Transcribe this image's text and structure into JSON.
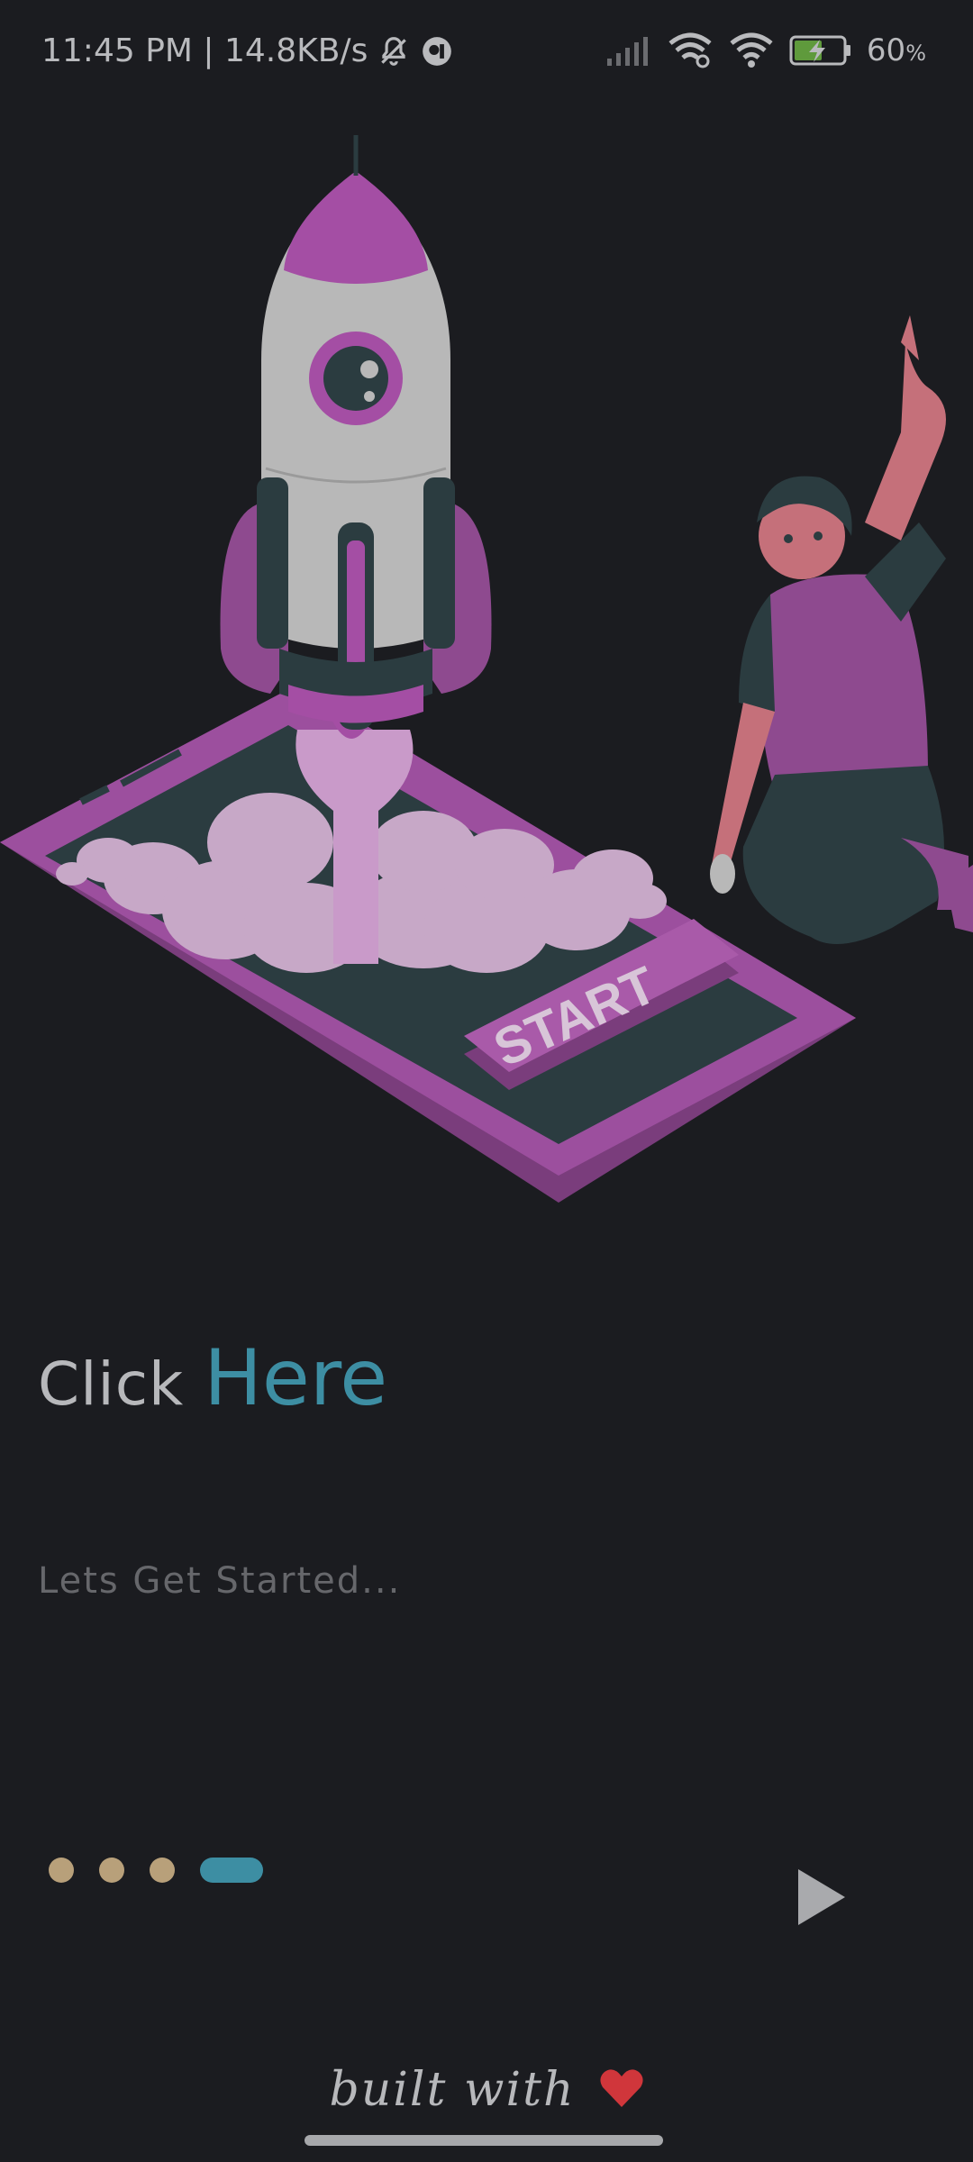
{
  "status_bar": {
    "time_speed": "11:45 PM | 14.8KB/s",
    "battery_percent": "60",
    "battery_unit": "%",
    "icons": [
      "mute-bell-icon",
      "app-notification-icon",
      "signal-icon",
      "wifi-link-icon",
      "wifi-icon",
      "battery-charging-icon"
    ]
  },
  "illustration": {
    "button_text": "START",
    "description_icon": "rocket-launch-illustration"
  },
  "headline": {
    "word1": "Click",
    "word2": "Here"
  },
  "subtitle": "Lets Get Started...",
  "pager": {
    "total": 4,
    "active_index": 3
  },
  "next_button": {
    "icon": "play-arrow-icon"
  },
  "footer": {
    "text": "built with",
    "icon": "heart-icon"
  },
  "colors": {
    "background": "#1b1c20",
    "accent": "#3d8ea3",
    "dot_inactive": "#b8a07a",
    "heart": "#d0363b",
    "purple": "#8e4a8f"
  }
}
